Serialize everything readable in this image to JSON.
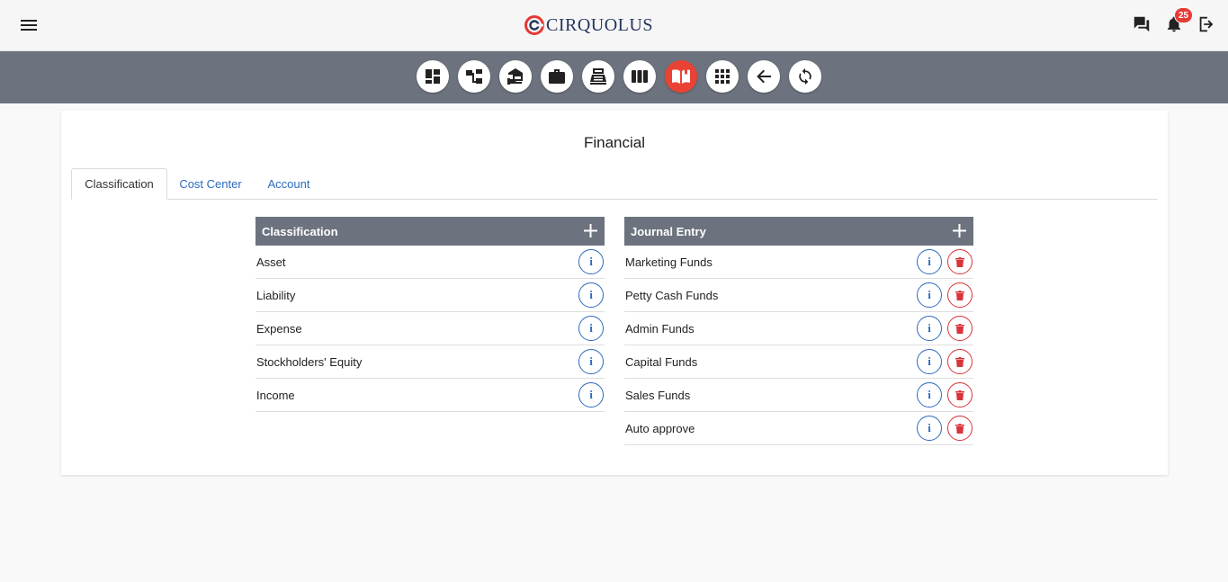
{
  "brand": {
    "name": "CIRQUOLUS"
  },
  "header": {
    "notification_count": "25"
  },
  "toolbar": {
    "buttons": [
      {
        "icon": "dashboard-icon"
      },
      {
        "icon": "hierarchy-icon"
      },
      {
        "icon": "hand-money-icon"
      },
      {
        "icon": "briefcase-icon"
      },
      {
        "icon": "cash-register-icon"
      },
      {
        "icon": "columns-icon"
      },
      {
        "icon": "open-book-icon",
        "active": true
      },
      {
        "icon": "apps-grid-icon"
      },
      {
        "icon": "arrow-back-icon"
      },
      {
        "icon": "refresh-icon"
      }
    ],
    "active_color": "#e94335",
    "bar_color": "#6c737e"
  },
  "page": {
    "title": "Financial",
    "tabs": [
      {
        "label": "Classification",
        "active": true
      },
      {
        "label": "Cost Center",
        "active": false
      },
      {
        "label": "Account",
        "active": false
      }
    ]
  },
  "classification_panel": {
    "title": "Classification",
    "rows": [
      "Asset",
      "Liability",
      "Expense",
      "Stockholders' Equity",
      "Income"
    ]
  },
  "journal_panel": {
    "title": "Journal Entry",
    "rows": [
      "Marketing Funds",
      "Petty Cash Funds",
      "Admin Funds",
      "Capital Funds",
      "Sales Funds",
      "Auto approve"
    ]
  },
  "colors": {
    "info": "#2d6bbd",
    "delete": "#d9343b",
    "badge": "#e53935"
  }
}
